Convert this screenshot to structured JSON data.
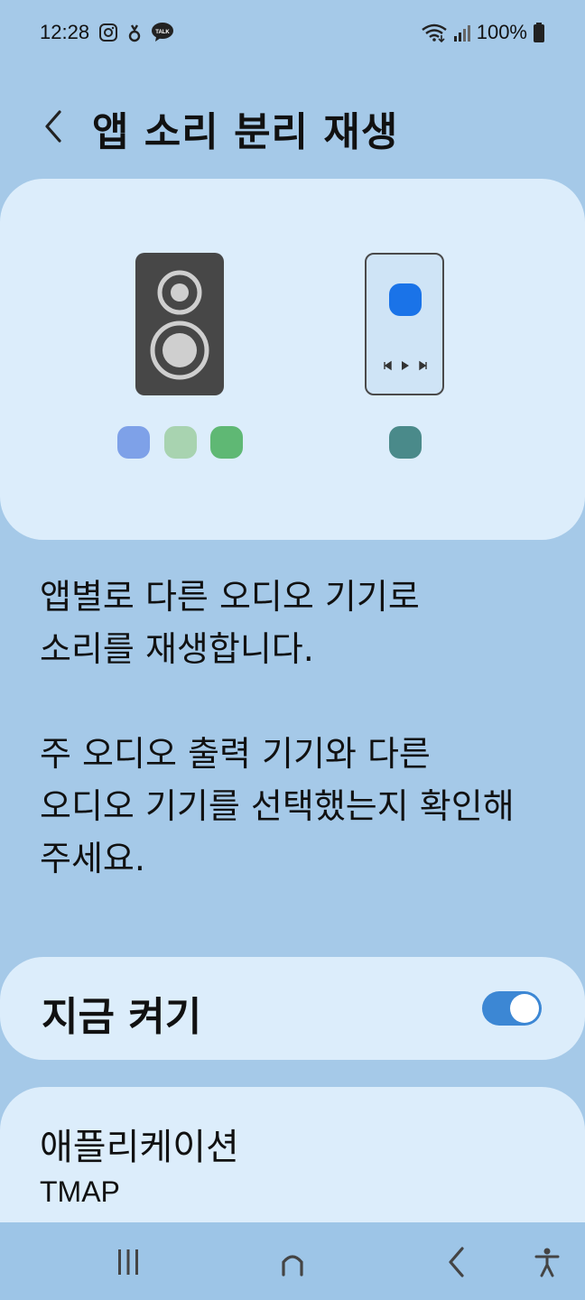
{
  "status_bar": {
    "time": "12:28",
    "notification_icons": [
      "instagram-icon",
      "app-icon",
      "kakaotalk-icon"
    ],
    "battery": "100%"
  },
  "header": {
    "title": "앱 소리 분리 재생",
    "back_icon": "chevron-left-icon"
  },
  "illustration": {
    "speaker_dots": [
      "#7ea1e8",
      "#a8d3b0",
      "#5fb874"
    ],
    "phone_dot": "#4a8a8a",
    "phone_app_color": "#1a73e8"
  },
  "description": {
    "line1": "앱별로 다른 오디오 기기로",
    "line2": "소리를 재생합니다.",
    "line3": "주 오디오 출력 기기와 다른",
    "line4": "오디오 기기를 선택했는지 확인해",
    "line5": "주세요."
  },
  "toggle": {
    "label": "지금 켜기",
    "on": true,
    "accent": "#3c87d4"
  },
  "app_section": {
    "title": "애플리케이션",
    "value": "TMAP"
  },
  "nav": {
    "recents_icon": "recents-icon",
    "home_icon": "home-icon",
    "back_icon": "back-icon",
    "accessibility_icon": "accessibility-icon"
  }
}
